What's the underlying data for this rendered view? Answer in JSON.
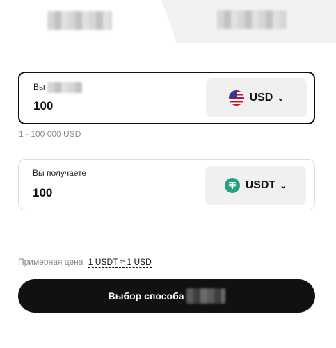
{
  "tabs": {
    "left_label": "",
    "right_label": ""
  },
  "pay": {
    "label": "Вы",
    "amount": "100",
    "currency": "USD",
    "icon": "us-flag-icon",
    "range": "1 - 100 000 USD"
  },
  "receive": {
    "label": "Вы получаете",
    "amount": "100",
    "currency": "USDT",
    "icon": "tether-icon"
  },
  "rate": {
    "label": "Примерная цена",
    "value": "1 USDT ≈ 1 USD"
  },
  "action": {
    "label": "Выбор способа"
  },
  "colors": {
    "accent": "#111111",
    "tether": "#26a17b",
    "border_active": "#111111",
    "border_passive": "#dcdcdc"
  }
}
